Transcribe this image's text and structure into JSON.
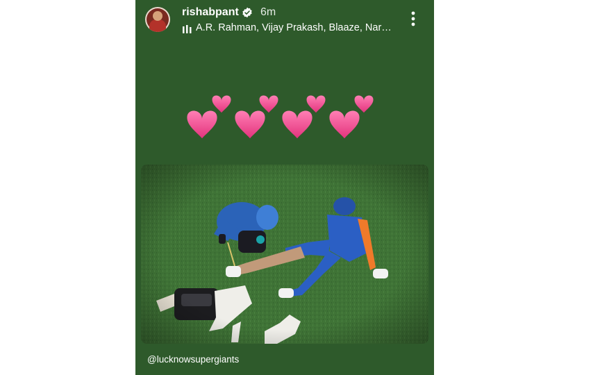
{
  "header": {
    "username": "rishabpant",
    "time_ago": "6m",
    "music": "A.R. Rahman, Vijay Prakash, Blaaze, Nar…"
  },
  "icons": {
    "verified": "verified-badge-icon",
    "music": "music-bars-icon",
    "more": "more-vertical-icon",
    "hearts": "pink-heart-emoji"
  },
  "sticker": {
    "mention": "@lucknowsupergiants"
  },
  "colors": {
    "story_background": "#2e5a2b",
    "heart": "#f2478f"
  }
}
